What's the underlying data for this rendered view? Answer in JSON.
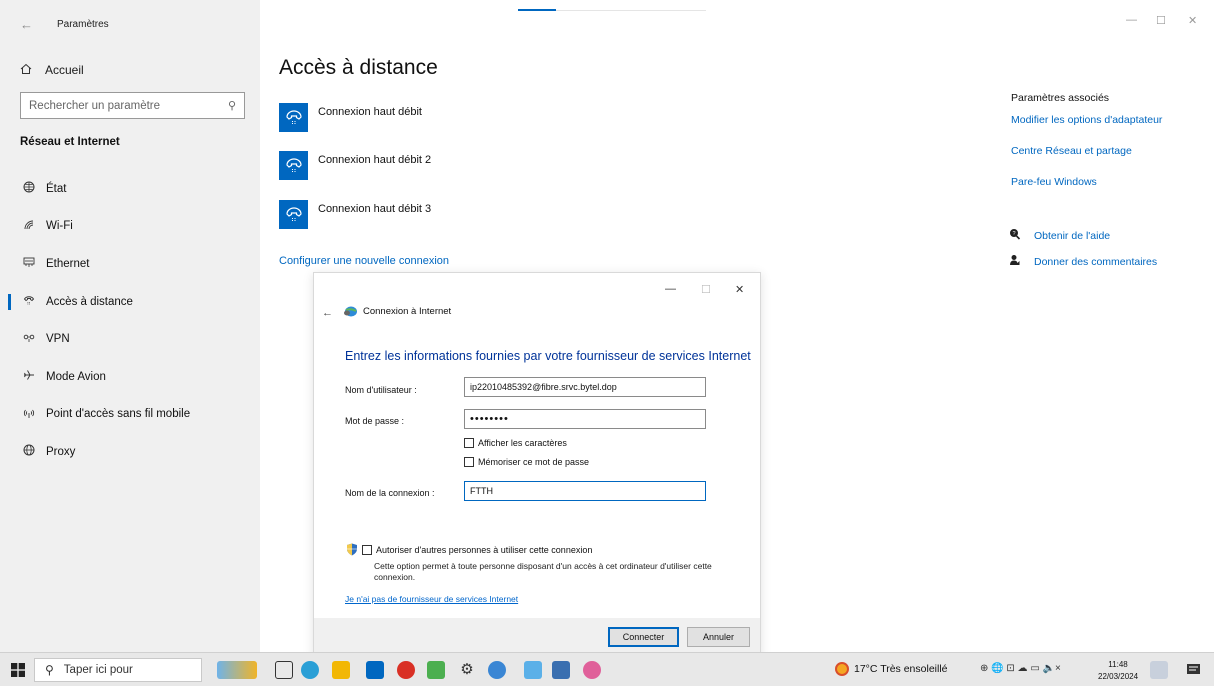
{
  "window": {
    "title": "Paramètres",
    "back_icon": "←",
    "minimize_icon": "—",
    "maximize_icon": "☐",
    "close_icon": "✕"
  },
  "sidebar": {
    "home_label": "Accueil",
    "search_placeholder": "Rechercher un paramètre",
    "section_title": "Réseau et Internet",
    "items": [
      {
        "label": "État",
        "icon": "globe-icon"
      },
      {
        "label": "Wi-Fi",
        "icon": "wifi-icon"
      },
      {
        "label": "Ethernet",
        "icon": "ethernet-icon"
      },
      {
        "label": "Accès à distance",
        "icon": "dialup-icon",
        "active": true
      },
      {
        "label": "VPN",
        "icon": "vpn-icon"
      },
      {
        "label": "Mode Avion",
        "icon": "airplane-icon"
      },
      {
        "label": "Point d'accès sans fil mobile",
        "icon": "hotspot-icon"
      },
      {
        "label": "Proxy",
        "icon": "proxy-globe-icon"
      }
    ]
  },
  "main": {
    "title": "Accès à distance",
    "connections": [
      {
        "name": "Connexion haut débit"
      },
      {
        "name": "Connexion haut débit 2"
      },
      {
        "name": "Connexion haut débit 3"
      }
    ],
    "new_connection_link": "Configurer une nouvelle connexion"
  },
  "related": {
    "title": "Paramètres associés",
    "links": [
      "Modifier les options d'adaptateur",
      "Centre Réseau et partage",
      "Pare-feu Windows"
    ],
    "help_label": "Obtenir de l'aide",
    "feedback_label": "Donner des commentaires"
  },
  "dialog": {
    "title": "Connexion à Internet",
    "heading": "Entrez les informations fournies par votre fournisseur de services Internet",
    "username_label": "Nom d'utilisateur :",
    "username_value": "ip22010485392@fibre.srvc.bytel.dop",
    "password_label": "Mot de passe :",
    "password_value": "password",
    "show_chars_label": "Afficher les caractères",
    "remember_label": "Mémoriser ce mot de passe",
    "connection_name_label": "Nom de la connexion :",
    "connection_name_value": "FTTH",
    "allow_others_label": "Autoriser d'autres personnes à utiliser cette connexion",
    "allow_others_desc": "Cette option permet à toute personne disposant d'un accès à cet ordinateur d'utiliser cette connexion.",
    "no_isp_link": "Je n'ai pas de fournisseur de services Internet",
    "connect_button": "Connecter",
    "cancel_button": "Annuler"
  },
  "taskbar": {
    "search_label": "Taper ici pour",
    "weather": "17°C  Très ensoleillé",
    "tray_text": "⊕ 🌐 ⊡ ☁ ▭ 🔈×",
    "time": "11:48",
    "date": "22/03/2024"
  },
  "colors": {
    "accent": "#0067c0",
    "sidebar_bg": "#f0f0f0",
    "dialog_heading": "#003399"
  }
}
